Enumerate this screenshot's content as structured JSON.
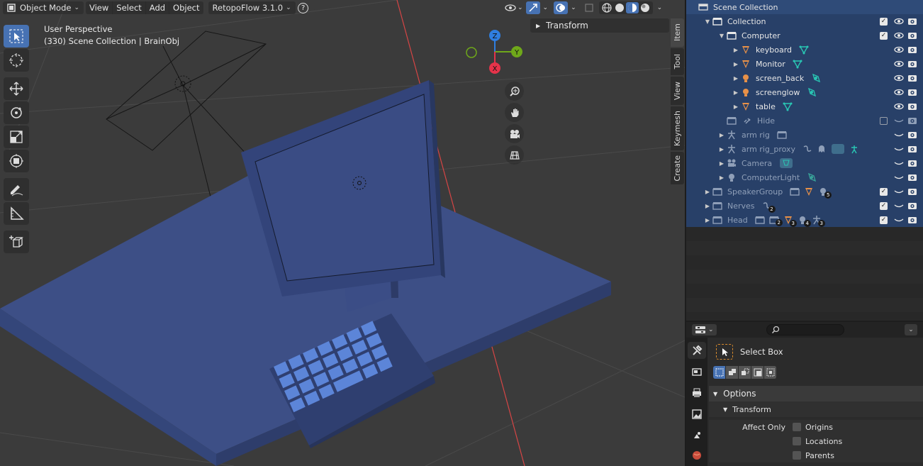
{
  "header": {
    "mode": "Object Mode",
    "menus": [
      "View",
      "Select",
      "Add",
      "Object"
    ],
    "addon": "RetopoFlow 3.1.0",
    "help": "?"
  },
  "overlay": {
    "line1": "User Perspective",
    "line2": "(330) Scene Collection | BrainObj"
  },
  "transform_panel": {
    "label": "Transform"
  },
  "side_tabs": [
    "Item",
    "Tool",
    "View",
    "Keymesh",
    "Create"
  ],
  "gizmo": {
    "z": "Z",
    "y": "Y",
    "x": "X"
  },
  "outliner": {
    "rows": [
      {
        "label": "Scene Collection"
      },
      {
        "label": "Collection"
      },
      {
        "label": "Computer"
      },
      {
        "label": "keyboard"
      },
      {
        "label": "Monitor"
      },
      {
        "label": "screen_back"
      },
      {
        "label": "screenglow"
      },
      {
        "label": "table"
      },
      {
        "label": "Hide"
      },
      {
        "label": "arm rig"
      },
      {
        "label": "arm rig_proxy"
      },
      {
        "label": "Camera"
      },
      {
        "label": "ComputerLight"
      },
      {
        "label": "SpeakerGroup",
        "badges": [
          "5"
        ]
      },
      {
        "label": "Nerves",
        "badges": [
          "2"
        ]
      },
      {
        "label": "Head",
        "badges": [
          "2",
          "3",
          "4",
          "3"
        ]
      }
    ]
  },
  "properties": {
    "tool_name": "Select Box",
    "options_label": "Options",
    "transform_label": "Transform",
    "affect_only_label": "Affect Only",
    "affect_only": [
      "Origins",
      "Locations",
      "Parents"
    ]
  },
  "colors": {
    "viewport_bg": "#3b3b3b",
    "outliner_selected": "#284068",
    "accent": "#4772b3",
    "object_blue": "#3a4e88",
    "axis_x": "#e5334a",
    "axis_y": "#6fa81a",
    "axis_z": "#2f7ee0"
  }
}
